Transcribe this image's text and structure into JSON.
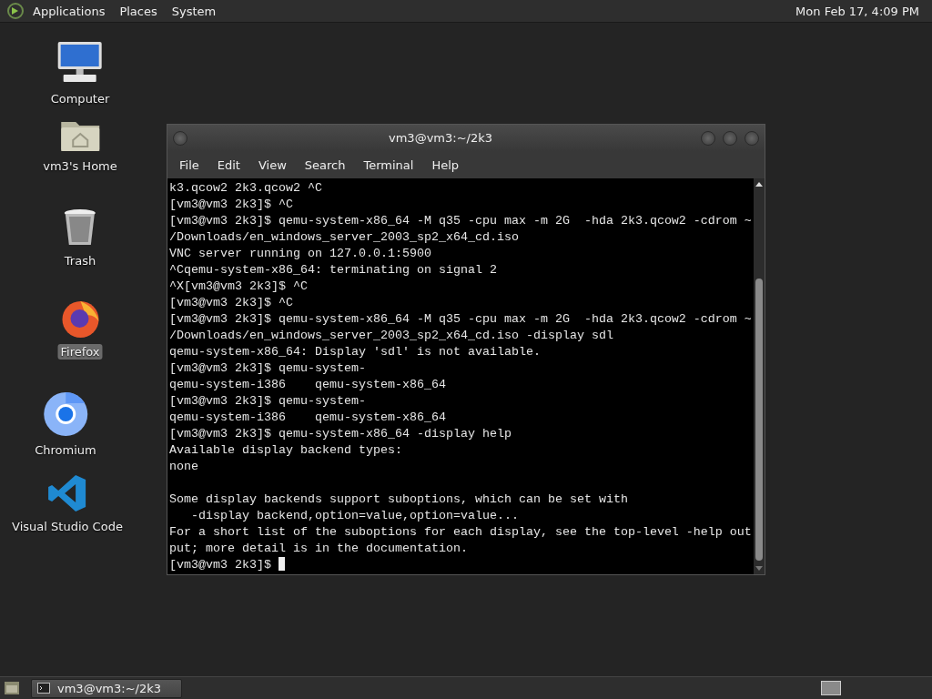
{
  "top_panel": {
    "menus": [
      "Applications",
      "Places",
      "System"
    ],
    "clock": "Mon Feb 17,  4:09 PM"
  },
  "desktop_icons": [
    {
      "kind": "computer",
      "label": "Computer",
      "selected": false
    },
    {
      "kind": "home",
      "label": "vm3's Home",
      "selected": false
    },
    {
      "kind": "trash",
      "label": "Trash",
      "selected": false
    },
    {
      "kind": "firefox",
      "label": "Firefox",
      "selected": true
    },
    {
      "kind": "chromium",
      "label": "Chromium",
      "selected": false
    },
    {
      "kind": "vscode",
      "label": "Visual Studio Code",
      "selected": false
    }
  ],
  "window": {
    "title": "vm3@vm3:~/2k3",
    "menus": [
      "File",
      "Edit",
      "View",
      "Search",
      "Terminal",
      "Help"
    ],
    "lines": [
      {
        "text": "k3.qcow2 2k3.qcow2 ^C"
      },
      {
        "text": "[vm3@vm3 2k3]$ ^C"
      },
      {
        "text": "[vm3@vm3 2k3]$ qemu-system-x86_64 -M q35 -cpu max -m 2G  -hda 2k3.qcow2 -cdrom ~"
      },
      {
        "text": "/Downloads/en_windows_server_2003_sp2_x64_cd.iso"
      },
      {
        "text": "VNC server running on 127.0.0.1:5900"
      },
      {
        "text": "^Cqemu-system-x86_64: terminating on signal 2"
      },
      {
        "text": "^X[vm3@vm3 2k3]$ ^C"
      },
      {
        "text": "[vm3@vm3 2k3]$ ^C"
      },
      {
        "text": "[vm3@vm3 2k3]$ qemu-system-x86_64 -M q35 -cpu max -m 2G  -hda 2k3.qcow2 -cdrom ~"
      },
      {
        "text": "/Downloads/en_windows_server_2003_sp2_x64_cd.iso -display sdl"
      },
      {
        "text": "qemu-system-x86_64: Display 'sdl' is not available."
      },
      {
        "text": "[vm3@vm3 2k3]$ qemu-system-"
      },
      {
        "text": "qemu-system-i386    qemu-system-x86_64"
      },
      {
        "text": "[vm3@vm3 2k3]$ qemu-system-"
      },
      {
        "text": "qemu-system-i386    qemu-system-x86_64"
      },
      {
        "text": "[vm3@vm3 2k3]$ qemu-system-x86_64 -display help"
      },
      {
        "text": "Available display backend types:"
      },
      {
        "text": "none"
      },
      {
        "text": "Some display backends support suboptions, which can be set with",
        "blank_before": true
      },
      {
        "text": "   -display backend,option=value,option=value..."
      },
      {
        "text": "For a short list of the suboptions for each display, see the top-level -help out"
      },
      {
        "text": "put; more detail is in the documentation."
      },
      {
        "text": "[vm3@vm3 2k3]$ ",
        "cursor": true
      }
    ]
  },
  "taskbar": {
    "tasks": [
      {
        "label": "vm3@vm3:~/2k3",
        "selected": true
      }
    ]
  }
}
